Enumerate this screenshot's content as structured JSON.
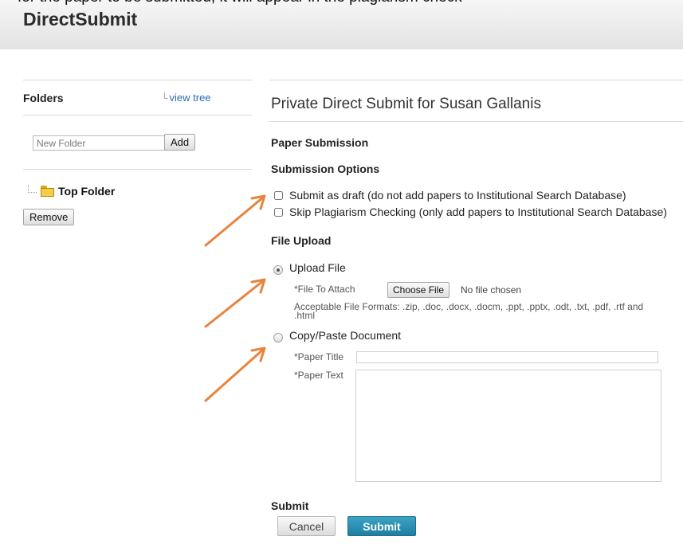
{
  "header": {
    "cut_off_text": "for the paper to be submitted, it will appear in the plagiarism check",
    "app_title": "DirectSubmit"
  },
  "sidebar": {
    "folders_heading": "Folders",
    "view_tree_link": "view tree",
    "new_folder_placeholder": "New Folder",
    "add_button": "Add",
    "tree_root_label": "Top Folder",
    "remove_button": "Remove"
  },
  "main": {
    "page_title": "Private Direct Submit for Susan Gallanis",
    "paper_submission_heading": "Paper Submission",
    "submission_options_heading": "Submission Options",
    "submission_options": [
      {
        "label": "Submit as draft (do not add papers to Institutional Search Database)",
        "checked": false
      },
      {
        "label": "Skip Plagiarism Checking (only add papers to Institutional Search Database)",
        "checked": false
      }
    ],
    "file_upload_heading": "File Upload",
    "upload_file_radio": {
      "label": "Upload File",
      "selected": true
    },
    "file_to_attach_label": "*File To Attach",
    "choose_file_button": "Choose File",
    "no_file_chosen": "No file chosen",
    "acceptable_formats": "Acceptable File Formats: .zip, .doc, .docx, .docm, .ppt, .pptx, .odt, .txt, .pdf, .rtf and .html",
    "copy_paste_radio": {
      "label": "Copy/Paste Document",
      "selected": false
    },
    "paper_title_label": "*Paper Title",
    "paper_title_value": "",
    "paper_text_label": "*Paper Text",
    "paper_text_value": "",
    "submit_heading": "Submit",
    "cancel_button": "Cancel",
    "submit_button": "Submit"
  },
  "colors": {
    "accent_arrow": "#e8843c",
    "submit_button": "#2a90b5",
    "link": "#2a6ab8"
  },
  "icons": [
    "tree-connector-icon",
    "folder-icon",
    "arrow-annotation-icon"
  ]
}
